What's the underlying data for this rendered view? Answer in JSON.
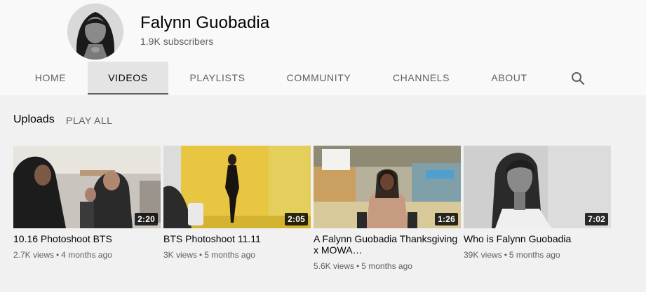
{
  "channel": {
    "name": "Falynn Guobadia",
    "subscribers": "1.9K subscribers"
  },
  "tabs": [
    {
      "label": "HOME",
      "active": false
    },
    {
      "label": "VIDEOS",
      "active": true
    },
    {
      "label": "PLAYLISTS",
      "active": false
    },
    {
      "label": "COMMUNITY",
      "active": false
    },
    {
      "label": "CHANNELS",
      "active": false
    },
    {
      "label": "ABOUT",
      "active": false
    }
  ],
  "search_icon": "search-icon",
  "section": {
    "title": "Uploads",
    "play_all": "PLAY ALL"
  },
  "videos": [
    {
      "title": "10.16 Photoshoot BTS",
      "duration": "2:20",
      "views": "2.7K views",
      "age": "4 months ago"
    },
    {
      "title": "BTS Photoshoot 11.11",
      "duration": "2:05",
      "views": "3K views",
      "age": "5 months ago"
    },
    {
      "title": "A Falynn Guobadia Thanksgiving x MOWA…",
      "duration": "1:26",
      "views": "5.6K views",
      "age": "5 months ago"
    },
    {
      "title": "Who is Falynn Guobadia",
      "duration": "7:02",
      "views": "39K views",
      "age": "5 months ago"
    }
  ],
  "colors": {
    "header_bg": "#f9f9f9",
    "page_bg": "#f1f1f1",
    "active_tab_bg": "#e4e4e4",
    "muted_text": "#606060"
  }
}
